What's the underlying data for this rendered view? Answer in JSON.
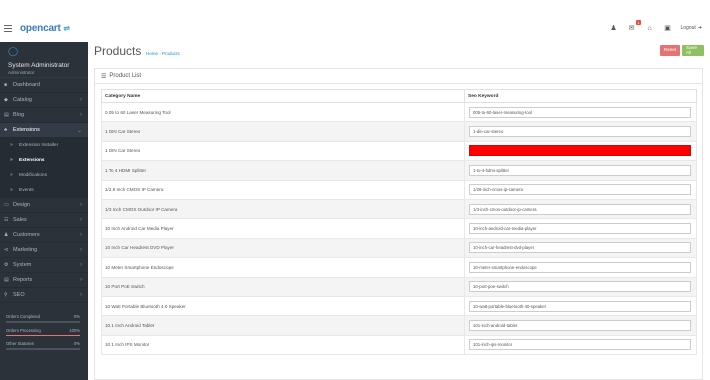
{
  "header": {
    "logo_text": "opencart",
    "alert_count": "1",
    "logout_label": "Logout"
  },
  "sidebar": {
    "user_name": "System Administrator",
    "user_role": "Administrator",
    "items": [
      {
        "label": "Dashboard",
        "icon": "dashboard-icon"
      },
      {
        "label": "Catalog",
        "icon": "tag-icon"
      },
      {
        "label": "Blog",
        "icon": "book-icon"
      },
      {
        "label": "Extensions",
        "icon": "puzzle-icon"
      },
      {
        "label": "Extension Installer",
        "icon": "arrow-icon"
      },
      {
        "label": "Extensions",
        "icon": "arrow-icon"
      },
      {
        "label": "Modifications",
        "icon": "arrow-icon"
      },
      {
        "label": "Events",
        "icon": "arrow-icon"
      },
      {
        "label": "Design",
        "icon": "monitor-icon"
      },
      {
        "label": "Sales",
        "icon": "cart-icon"
      },
      {
        "label": "Customers",
        "icon": "user-icon"
      },
      {
        "label": "Marketing",
        "icon": "share-icon"
      },
      {
        "label": "System",
        "icon": "cog-icon"
      },
      {
        "label": "Reports",
        "icon": "bar-chart-icon"
      },
      {
        "label": "SEO",
        "icon": "search-icon"
      }
    ],
    "stats": [
      {
        "label": "Orders Completed",
        "value": "0%",
        "fraction": 0,
        "color": "#8fbf5f"
      },
      {
        "label": "Orders Processing",
        "value": "100%",
        "fraction": 1,
        "color": "#e57373"
      },
      {
        "label": "Other Statuses",
        "value": "0%",
        "fraction": 0,
        "color": "#2aa3d8"
      }
    ]
  },
  "page": {
    "title": "Products",
    "breadcrumb_home": "Home",
    "breadcrumb_current": "Products",
    "reset_label": "Reset",
    "save_label": "Save All",
    "panel_title": "Product List"
  },
  "table": {
    "headers": [
      "Category Name",
      "Seo Keyword"
    ],
    "rows": [
      {
        "name": "0.05 to 60 Laser Measuring Tool",
        "keyword": "005-to-60-laser-measuring-tool",
        "error": false
      },
      {
        "name": "1 DIN Car Stereo",
        "keyword": "1-din-car-stereo",
        "error": false
      },
      {
        "name": "1 DIN Car Stereo",
        "keyword": "",
        "error": true
      },
      {
        "name": "1 To 4 HDMI Splitter",
        "keyword": "1-to-4-hdmi-splitter",
        "error": false
      },
      {
        "name": "1/2.8 Inch CMOS IP Camera",
        "keyword": "1/28-inch-cmos-ip-camera",
        "error": false
      },
      {
        "name": "1/3 Inch CMOS Outdoor IP Camera",
        "keyword": "1/3-inch-cmos-outdoor-ip-camera",
        "error": false
      },
      {
        "name": "10 Inch Android Car Media Player",
        "keyword": "10-inch-android-car-media-player",
        "error": false
      },
      {
        "name": "10 Inch Car Headrest DVD Player",
        "keyword": "10-inch-car-headrest-dvd-player",
        "error": false
      },
      {
        "name": "10 Meter Smartphone Endoscope",
        "keyword": "10-meter-smartphone-endoscope",
        "error": false
      },
      {
        "name": "10 Port PoE Switch",
        "keyword": "10-port-poe-switch",
        "error": false
      },
      {
        "name": "10 Watt Portable Bluetooth 4.0 Speaker",
        "keyword": "10-watt-portable-bluetooth-40-speaker",
        "error": false
      },
      {
        "name": "10.1 Inch Android Tablet",
        "keyword": "101-inch-android-tablet",
        "error": false
      },
      {
        "name": "10.1 Inch IPS Monitor",
        "keyword": "101-inch-ips-monitor",
        "error": false
      }
    ]
  }
}
